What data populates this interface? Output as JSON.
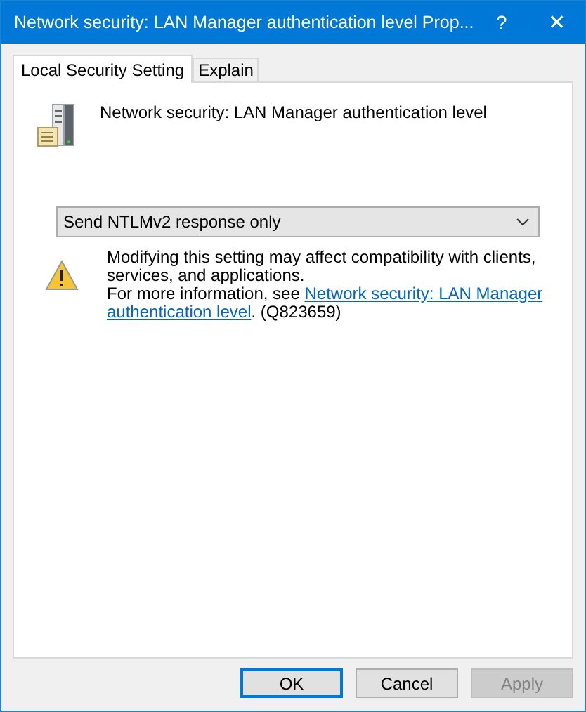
{
  "window": {
    "title": "Network security: LAN Manager authentication level Prop...",
    "help": "?",
    "close": "✕"
  },
  "tabs": [
    {
      "label": "Local Security Setting",
      "selected": true
    },
    {
      "label": "Explain",
      "selected": false
    }
  ],
  "policy": {
    "name": "Network security: LAN Manager authentication level"
  },
  "dropdown": {
    "value": "Send NTLMv2 response only"
  },
  "warning": {
    "message": "Modifying this setting may affect compatibility with clients, services, and applications.",
    "info_prefix": "For more information, see",
    "link_lines": [
      "Network security: LAN Manager",
      "authentication level"
    ],
    "info_suffix": ". (Q823659)"
  },
  "buttons": [
    {
      "label": "OK",
      "default": true,
      "disabled": false
    },
    {
      "label": "Cancel",
      "default": false,
      "disabled": false
    },
    {
      "label": "Apply",
      "default": false,
      "disabled": true
    }
  ]
}
